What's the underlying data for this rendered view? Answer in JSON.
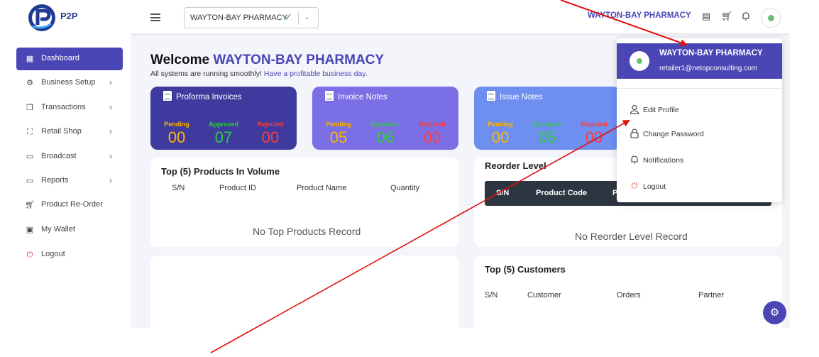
{
  "brand": {
    "logo_text": "P2P"
  },
  "header": {
    "store_select_value": "WAYTON-BAY PHARMACY",
    "store_name": "WAYTON-BAY PHARMACY",
    "icons": [
      "list-icon",
      "cart-icon",
      "bell-icon",
      "avatar"
    ]
  },
  "sidebar": {
    "items": [
      {
        "label": "Dashboard",
        "icon": "dashboard-icon",
        "active": true,
        "has_submenu": false
      },
      {
        "label": "Business Setup",
        "icon": "gear-icon",
        "has_submenu": true
      },
      {
        "label": "Transactions",
        "icon": "copy-icon",
        "has_submenu": true
      },
      {
        "label": "Retail Shop",
        "icon": "shop-icon",
        "has_submenu": true
      },
      {
        "label": "Broadcast",
        "icon": "folder-icon",
        "has_submenu": true
      },
      {
        "label": "Reports",
        "icon": "folder-icon",
        "has_submenu": true
      },
      {
        "label": "Product Re-Order",
        "icon": "cart-icon",
        "has_submenu": false
      },
      {
        "label": "My Wallet",
        "icon": "wallet-icon",
        "has_submenu": false
      },
      {
        "label": "Logout",
        "icon": "power-icon",
        "has_submenu": false
      }
    ]
  },
  "welcome": {
    "prefix": "Welcome",
    "name": "WAYTON-BAY PHARMACY",
    "status": "All systems are running smoothly!",
    "wish": "Have a profitable business day."
  },
  "stats": [
    {
      "title": "Proforma Invoices",
      "color": "#3f3b9e",
      "pending_label": "Pending",
      "pending": "00",
      "approved_label": "Approved",
      "approved": "07",
      "rejected_label": "Rejected",
      "rejected": "00"
    },
    {
      "title": "Invoice Notes",
      "color": "#7b6fe6",
      "pending_label": "Pending",
      "pending": "05",
      "approved_label": "Approved",
      "approved": "06",
      "rejected_label": "Rejected",
      "rejected": "00"
    },
    {
      "title": "Issue Notes",
      "color": "#6e8ef0",
      "pending_label": "Pending",
      "pending": "00",
      "approved_label": "Approved",
      "approved": "05",
      "rejected_label": "Rejected",
      "rejected": "00"
    }
  ],
  "top_products": {
    "title": "Top (5) Products In Volume",
    "columns": [
      "S/N",
      "Product ID",
      "Product Name",
      "Quantity"
    ],
    "empty": "No Top Products Record"
  },
  "reorder": {
    "title": "Reorder Level",
    "columns": [
      "S/N",
      "Product Code",
      "P"
    ],
    "empty": "No Reorder Level Record"
  },
  "top_customers": {
    "title": "Top (5) Customers",
    "columns": [
      "S/N",
      "Customer",
      "Orders",
      "Partner"
    ]
  },
  "profile_menu": {
    "name": "WAYTON-BAY PHARMACY",
    "email": "retailer1@netopconsulting.com",
    "items": [
      {
        "label": "Edit Profile",
        "icon": "user-icon"
      },
      {
        "label": "Change Password",
        "icon": "lock-icon"
      },
      {
        "label": "Notifications",
        "icon": "bell-icon"
      },
      {
        "label": "Logout",
        "icon": "power-icon"
      }
    ]
  },
  "colors": {
    "accent": "#4a46b5",
    "annotation_arrow": "#e01010"
  }
}
